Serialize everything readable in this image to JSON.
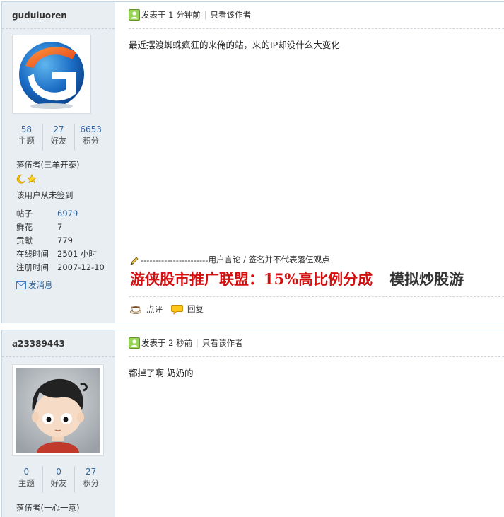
{
  "posts": [
    {
      "author": "guduluoren",
      "stats": [
        {
          "value": "58",
          "label": "主题"
        },
        {
          "value": "27",
          "label": "好友"
        },
        {
          "value": "6653",
          "label": "积分"
        }
      ],
      "rank": "落伍者(三羊开泰)",
      "sign_status": "该用户从未签到",
      "details": [
        {
          "key": "帖子",
          "value": "6979"
        },
        {
          "key": "鲜花",
          "value": "7"
        },
        {
          "key": "贡献",
          "value": "779"
        },
        {
          "key": "在线时间",
          "value": "2501 小时"
        },
        {
          "key": "注册时间",
          "value": "2007-12-10"
        }
      ],
      "send_message": "发消息",
      "posted_at": "发表于 1 分钟前",
      "author_only": "只看该作者",
      "content": "最近摆渡蜘蛛疯狂的来俺的站，来的IP却没什么大变化",
      "sig_note": "用户言论 / 签名并不代表落伍观点",
      "sig_dashes": "-----------------------",
      "ad_red": "游侠股市推广联盟：15%高比例分成",
      "ad_dark": "模拟炒股游",
      "comment": "点评",
      "reply": "回复"
    },
    {
      "author": "a23389443",
      "stats": [
        {
          "value": "0",
          "label": "主题"
        },
        {
          "value": "0",
          "label": "好友"
        },
        {
          "value": "27",
          "label": "积分"
        }
      ],
      "rank": "落伍者(一心一意)",
      "posted_at": "发表于 2 秒前",
      "author_only": "只看该作者",
      "content": "都掉了啊 奶奶的"
    }
  ],
  "colors": {
    "link": "#336699",
    "ad_red": "#d40f0f",
    "sidebar_bg": "#e9eef2",
    "border": "#c2d5e3"
  },
  "icons": {
    "post_meta": "user-post-icon",
    "moon": "moon-icon",
    "star": "star-icon",
    "mail": "mail-icon",
    "pen": "pencil-icon",
    "comment": "coffee-cup-icon",
    "reply": "speech-bubble-icon"
  }
}
